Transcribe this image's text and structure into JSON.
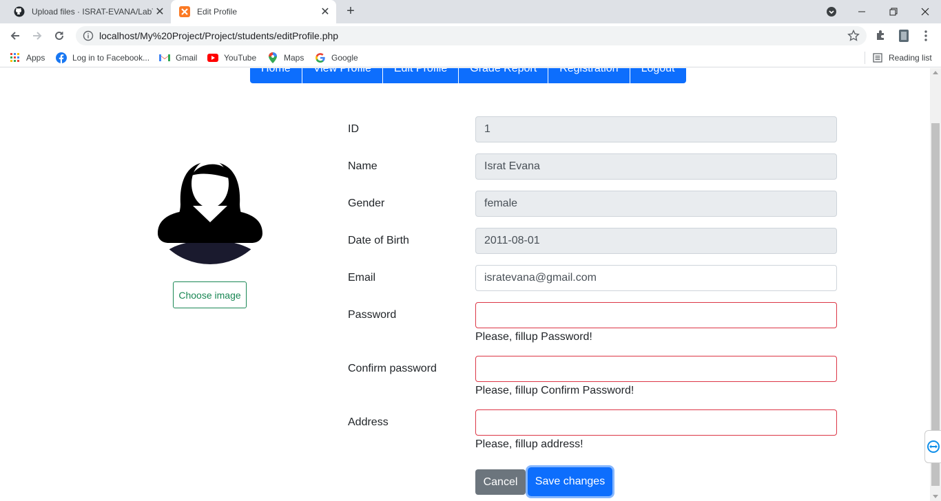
{
  "browser": {
    "tabs": [
      {
        "title": "Upload files · ISRAT-EVANA/LabT",
        "icon": "github-icon"
      },
      {
        "title": "Edit Profile",
        "icon": "xampp-icon"
      }
    ],
    "url": "localhost/My%20Project/Project/students/editProfile.php",
    "bookmarks": [
      {
        "label": "Apps",
        "icon": "apps-grid-icon"
      },
      {
        "label": "Log in to Facebook...",
        "icon": "facebook-icon"
      },
      {
        "label": "Gmail",
        "icon": "gmail-icon"
      },
      {
        "label": "YouTube",
        "icon": "youtube-icon"
      },
      {
        "label": "Maps",
        "icon": "maps-icon"
      },
      {
        "label": "Google",
        "icon": "google-icon"
      }
    ],
    "reading_list": "Reading list"
  },
  "nav": {
    "items": [
      "Home",
      "View Profile",
      "Edit Profile",
      "Grade Report",
      "Registration",
      "Logout"
    ]
  },
  "profile": {
    "choose_image": "Choose image"
  },
  "form": {
    "id_label": "ID",
    "id_value": "1",
    "name_label": "Name",
    "name_value": "Israt Evana",
    "gender_label": "Gender",
    "gender_value": "female",
    "dob_label": "Date of Birth",
    "dob_value": "2011-08-01",
    "email_label": "Email",
    "email_value": "isratevana@gmail.com",
    "password_label": "Password",
    "password_error": "Please, fillup Password!",
    "confirm_label": "Confirm password",
    "confirm_error": "Please, fillup Confirm Password!",
    "address_label": "Address",
    "address_error": "Please, fillup address!",
    "cancel": "Cancel",
    "save": "Save changes"
  },
  "colors": {
    "primary": "#0d6efd",
    "secondary": "#6c757d",
    "success": "#198754",
    "danger": "#dc3545"
  }
}
